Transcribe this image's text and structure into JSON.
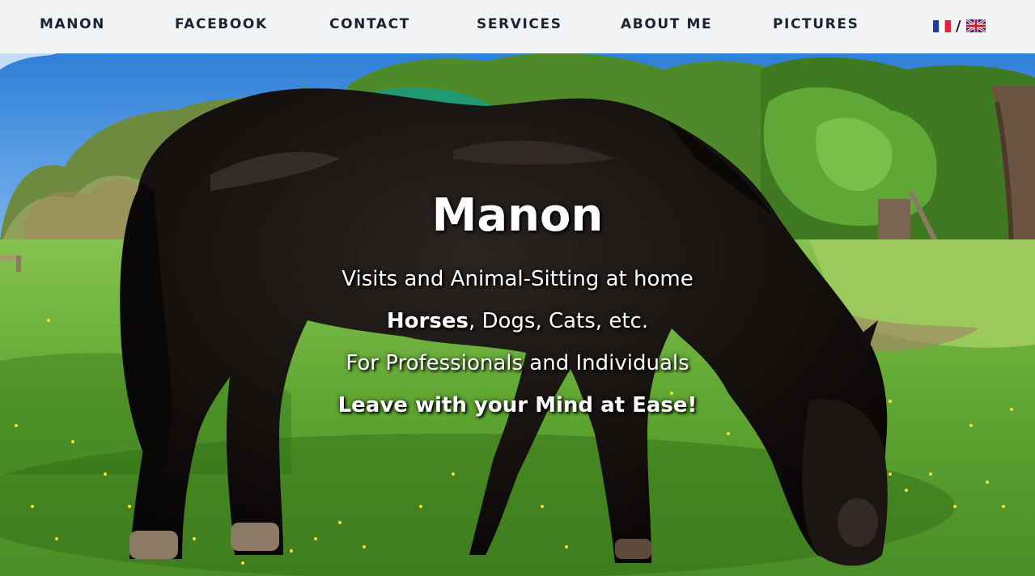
{
  "nav": {
    "items": [
      {
        "label": "MANON"
      },
      {
        "label": "FACEBOOK"
      },
      {
        "label": "CONTACT"
      },
      {
        "label": "SERVICES"
      },
      {
        "label": "ABOUT ME"
      },
      {
        "label": "PICTURES"
      }
    ],
    "lang_separator": "/",
    "languages": [
      {
        "icon": "french-flag-icon"
      },
      {
        "icon": "uk-flag-icon"
      }
    ]
  },
  "hero": {
    "title": "Manon",
    "line1": "Visits and Animal-Sitting at home",
    "line2_bold": "Horses",
    "line2_rest": ", Dogs, Cats, etc.",
    "line3": "For Professionals and Individuals",
    "line4": "Leave with your Mind at Ease!"
  }
}
